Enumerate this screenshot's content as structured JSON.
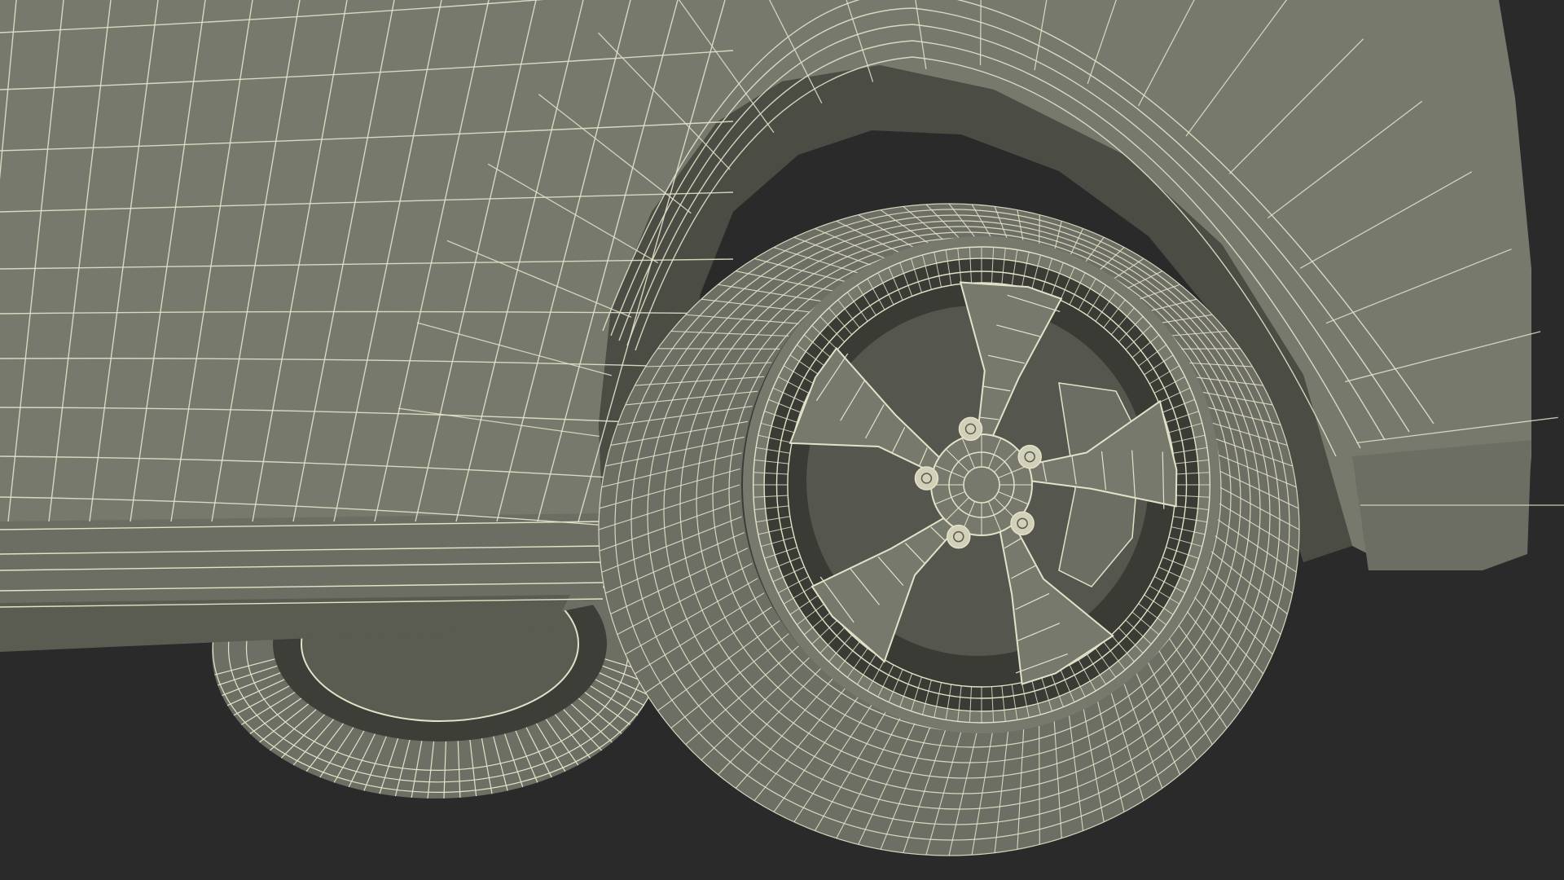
{
  "scene": {
    "subject": "car-rear-wheel-wireframe",
    "colors": {
      "background": "#2a2a2b",
      "surface": "#78796d",
      "surface_dark": "#5a5b51",
      "surface_shadow": "#4b4c44",
      "tire": "#6e6f64",
      "wire": "#e4e2c9",
      "wire_soft": "#d2d0b8"
    },
    "wheel": {
      "spoke_count": 5,
      "lug_nut_count": 5
    }
  }
}
